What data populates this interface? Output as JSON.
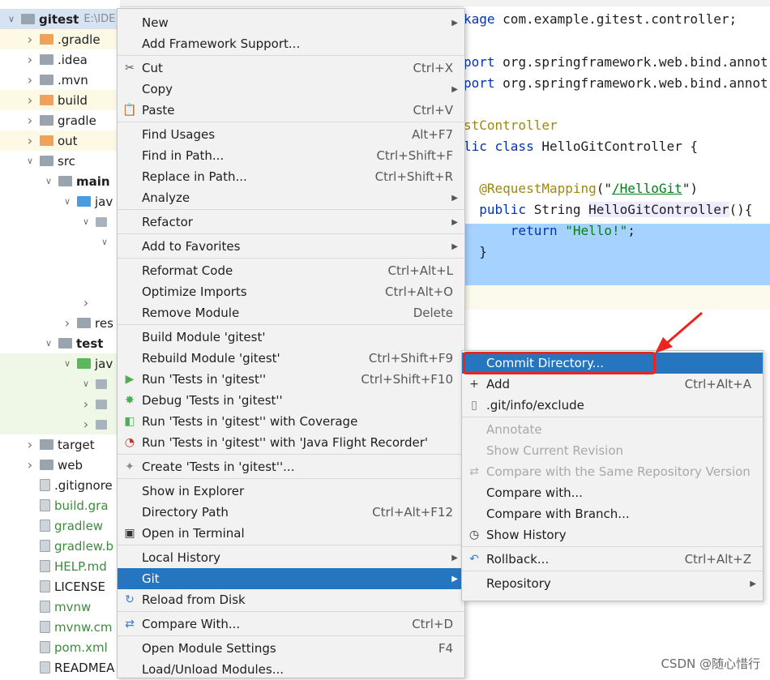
{
  "project_tree": [
    {
      "label": "gitest",
      "extra": "E:\\IDE",
      "level": 0,
      "arrow": "v",
      "icon": "folder-gray",
      "bold": true,
      "row": "sel"
    },
    {
      "label": ".gradle",
      "level": 1,
      "arrow": ">",
      "icon": "folder-orange",
      "row": "hl-yellow"
    },
    {
      "label": ".idea",
      "level": 1,
      "arrow": ">",
      "icon": "folder-gray",
      "row": ""
    },
    {
      "label": ".mvn",
      "level": 1,
      "arrow": ">",
      "icon": "folder-gray",
      "row": ""
    },
    {
      "label": "build",
      "level": 1,
      "arrow": ">",
      "icon": "folder-orange",
      "row": "hl-yellow"
    },
    {
      "label": "gradle",
      "level": 1,
      "arrow": ">",
      "icon": "folder-gray",
      "row": ""
    },
    {
      "label": "out",
      "level": 1,
      "arrow": ">",
      "icon": "folder-orange",
      "row": "hl-yellow"
    },
    {
      "label": "src",
      "level": 1,
      "arrow": "v",
      "icon": "folder-gray",
      "row": ""
    },
    {
      "label": "main",
      "level": 2,
      "arrow": "v",
      "icon": "folder-gray",
      "bold": true,
      "row": ""
    },
    {
      "label": "jav",
      "level": 3,
      "arrow": "v",
      "icon": "folder-blue",
      "row": ""
    },
    {
      "label": "",
      "level": 4,
      "arrow": "v",
      "icon": "folder-pkg",
      "row": ""
    },
    {
      "label": "",
      "level": 5,
      "arrow": "v",
      "icon": "",
      "row": ""
    },
    {
      "label": "",
      "level": 5,
      "arrow": "",
      "icon": "",
      "row": ""
    },
    {
      "label": "",
      "level": 5,
      "arrow": "",
      "icon": "",
      "row": ""
    },
    {
      "label": "",
      "level": 4,
      "arrow": ">",
      "icon": "",
      "row": ""
    },
    {
      "label": "res",
      "level": 3,
      "arrow": ">",
      "icon": "folder-gray",
      "row": ""
    },
    {
      "label": "test",
      "level": 2,
      "arrow": "v",
      "icon": "folder-gray",
      "bold": true,
      "row": ""
    },
    {
      "label": "jav",
      "level": 3,
      "arrow": "v",
      "icon": "folder-green",
      "row": "hl-green"
    },
    {
      "label": "",
      "level": 4,
      "arrow": "v",
      "icon": "folder-pkg",
      "row": "hl-green"
    },
    {
      "label": "",
      "level": 4,
      "arrow": ">",
      "icon": "folder-pkg",
      "row": "hl-green"
    },
    {
      "label": "",
      "level": 4,
      "arrow": ">",
      "icon": "folder-pkg",
      "row": "hl-green"
    },
    {
      "label": "target",
      "level": 1,
      "arrow": ">",
      "icon": "folder-gray",
      "row": ""
    },
    {
      "label": "web",
      "level": 1,
      "arrow": ">",
      "icon": "folder-gray",
      "row": ""
    },
    {
      "label": ".gitignore",
      "level": 1,
      "arrow": "",
      "icon": "file-icon",
      "row": ""
    },
    {
      "label": "build.gra",
      "level": 1,
      "arrow": "",
      "icon": "file-icon",
      "green": true,
      "row": ""
    },
    {
      "label": "gradlew",
      "level": 1,
      "arrow": "",
      "icon": "file-icon",
      "green": true,
      "row": ""
    },
    {
      "label": "gradlew.b",
      "level": 1,
      "arrow": "",
      "icon": "file-icon",
      "green": true,
      "row": ""
    },
    {
      "label": "HELP.md",
      "level": 1,
      "arrow": "",
      "icon": "file-icon",
      "green": true,
      "row": ""
    },
    {
      "label": "LICENSE",
      "level": 1,
      "arrow": "",
      "icon": "file-icon",
      "row": ""
    },
    {
      "label": "mvnw",
      "level": 1,
      "arrow": "",
      "icon": "file-icon",
      "green": true,
      "row": ""
    },
    {
      "label": "mvnw.cm",
      "level": 1,
      "arrow": "",
      "icon": "file-icon",
      "green": true,
      "row": ""
    },
    {
      "label": "pom.xml",
      "level": 1,
      "arrow": "",
      "icon": "file-icon",
      "green": true,
      "row": ""
    },
    {
      "label": "READMEA",
      "level": 1,
      "arrow": "",
      "icon": "file-icon",
      "row": ""
    }
  ],
  "editor": {
    "lines": [
      {
        "parts": [
          [
            "kw",
            "kage "
          ],
          [
            "",
            "com.example.gitest.controller;"
          ]
        ]
      },
      {
        "parts": []
      },
      {
        "parts": [
          [
            "kw",
            "port "
          ],
          [
            "",
            "org.springframework.web.bind.annot"
          ]
        ]
      },
      {
        "parts": [
          [
            "kw",
            "port "
          ],
          [
            "",
            "org.springframework.web.bind.annot"
          ]
        ]
      },
      {
        "parts": []
      },
      {
        "parts": [
          [
            "ann",
            "stController"
          ]
        ]
      },
      {
        "parts": [
          [
            "kw",
            "lic class "
          ],
          [
            "",
            "HelloGitController {"
          ]
        ]
      },
      {
        "parts": []
      },
      {
        "parts": [
          [
            "",
            "  "
          ],
          [
            "ann",
            "@RequestMapping"
          ],
          [
            "",
            "(\""
          ],
          [
            "lnk",
            "/HelloGit"
          ],
          [
            "",
            "\")"
          ]
        ]
      },
      {
        "parts": [
          [
            "",
            "  "
          ],
          [
            "kw",
            "public "
          ],
          [
            "",
            "String "
          ],
          [
            "hl",
            "HelloGitController"
          ],
          [
            "",
            "(){"
          ]
        ]
      },
      {
        "parts": [
          [
            "",
            "      "
          ],
          [
            "kw",
            "return "
          ],
          [
            "str",
            "\"Hello!\""
          ],
          [
            "",
            ";"
          ]
        ]
      },
      {
        "parts": [
          [
            "",
            "  }"
          ]
        ]
      }
    ]
  },
  "context_menu": [
    {
      "label": "New",
      "arrow": true
    },
    {
      "label": "Add Framework Support...",
      "sep_after": true
    },
    {
      "label": "Cut",
      "shortcut": "Ctrl+X",
      "icon": "scissors-icon"
    },
    {
      "label": "Copy",
      "arrow": true
    },
    {
      "label": "Paste",
      "shortcut": "Ctrl+V",
      "icon": "clipboard-icon",
      "sep_after": true
    },
    {
      "label": "Find Usages",
      "shortcut": "Alt+F7"
    },
    {
      "label": "Find in Path...",
      "shortcut": "Ctrl+Shift+F"
    },
    {
      "label": "Replace in Path...",
      "shortcut": "Ctrl+Shift+R"
    },
    {
      "label": "Analyze",
      "arrow": true,
      "sep_after": true
    },
    {
      "label": "Refactor",
      "arrow": true,
      "sep_after": true
    },
    {
      "label": "Add to Favorites",
      "arrow": true,
      "sep_after": true
    },
    {
      "label": "Reformat Code",
      "shortcut": "Ctrl+Alt+L"
    },
    {
      "label": "Optimize Imports",
      "shortcut": "Ctrl+Alt+O"
    },
    {
      "label": "Remove Module",
      "shortcut": "Delete",
      "sep_after": true
    },
    {
      "label": "Build Module 'gitest'"
    },
    {
      "label": "Rebuild Module 'gitest'",
      "shortcut": "Ctrl+Shift+F9"
    },
    {
      "label": "Run 'Tests in 'gitest''",
      "shortcut": "Ctrl+Shift+F10",
      "icon": "run-icon"
    },
    {
      "label": "Debug 'Tests in 'gitest''",
      "icon": "debug-icon"
    },
    {
      "label": "Run 'Tests in 'gitest'' with Coverage",
      "icon": "coverage-icon"
    },
    {
      "label": "Run 'Tests in 'gitest'' with 'Java Flight Recorder'",
      "icon": "profiler-icon",
      "sep_after": true
    },
    {
      "label": "Create 'Tests in 'gitest''...",
      "icon": "create-test-icon",
      "sep_after": true
    },
    {
      "label": "Show in Explorer"
    },
    {
      "label": "Directory Path",
      "shortcut": "Ctrl+Alt+F12"
    },
    {
      "label": "Open in Terminal",
      "icon": "terminal-icon",
      "sep_after": true
    },
    {
      "label": "Local History",
      "arrow": true
    },
    {
      "label": "Git",
      "arrow": true,
      "active": true
    },
    {
      "label": "Reload from Disk",
      "icon": "reload-icon",
      "sep_after": true
    },
    {
      "label": "Compare With...",
      "shortcut": "Ctrl+D",
      "icon": "compare-icon",
      "sep_after": true
    },
    {
      "label": "Open Module Settings",
      "shortcut": "F4"
    },
    {
      "label": "Load/Unload Modules..."
    }
  ],
  "git_submenu": [
    {
      "label": "Commit Directory...",
      "active": true
    },
    {
      "label": "Add",
      "shortcut": "Ctrl+Alt+A",
      "icon": "plus-icon"
    },
    {
      "label": ".git/info/exclude",
      "icon": "file-icon",
      "sep_after": true
    },
    {
      "label": "Annotate",
      "disabled": true
    },
    {
      "label": "Show Current Revision",
      "disabled": true
    },
    {
      "label": "Compare with the Same Repository Version",
      "disabled": true,
      "icon": "compare-icon"
    },
    {
      "label": "Compare with..."
    },
    {
      "label": "Compare with Branch..."
    },
    {
      "label": "Show History",
      "icon": "clock-icon",
      "sep_after": true
    },
    {
      "label": "Rollback...",
      "shortcut": "Ctrl+Alt+Z",
      "icon": "rollback-icon",
      "sep_after": true
    },
    {
      "label": "Repository",
      "arrow": true
    }
  ],
  "watermark": "CSDN @随心惜行",
  "colors": {
    "menu_active": "#2675bf",
    "annotation_box": "#e8251f",
    "selection": "#a6d2ff"
  }
}
